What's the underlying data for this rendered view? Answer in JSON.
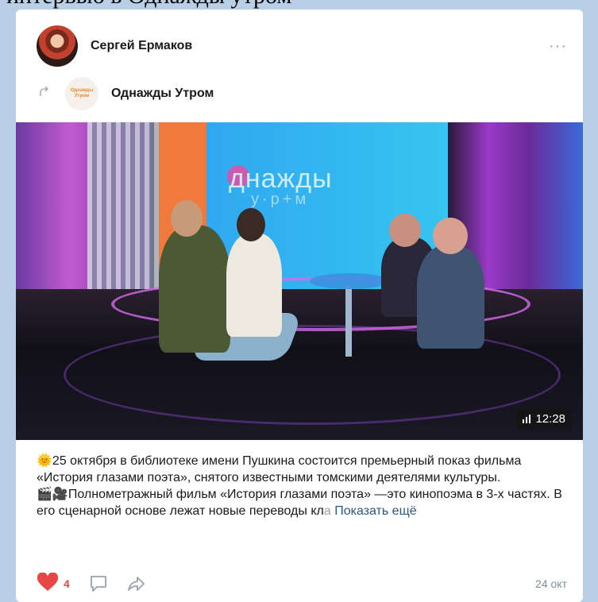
{
  "top_fragment": "интервью в Однажды утром",
  "post": {
    "author_name": "Сергей Ермаков",
    "more_label": "···",
    "group_name": "Однажды Утром",
    "group_logo_text": "Однажды Утром",
    "video": {
      "duration": "12:28",
      "overlay_title": "днажды",
      "overlay_subtitle": "у·р+м"
    },
    "text_lines": [
      "🌞25 октября в библиотеке имени Пушкина состоится премьерный показ фильма «История глазами поэта», снятого известными томскими деятелями культуры.",
      "🎬🎥Полнометражный фильм «История глазами поэта» —это кинопоэма в 3-х частях. В его сценарной основе лежат новые переводы кл"
    ],
    "text_fade": "а",
    "show_more": "Показать ещё",
    "likes": "4",
    "date": "24 окт"
  },
  "colors": {
    "like": "#e64646",
    "link": "#2a5885",
    "page_bg": "#b9cfe6"
  }
}
